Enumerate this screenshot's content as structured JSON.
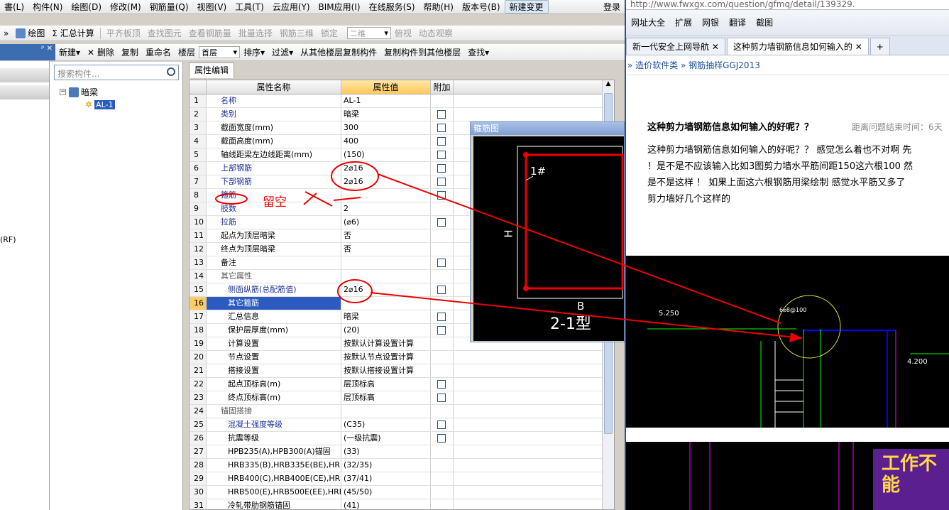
{
  "menu": [
    "書(L)",
    "构件(N)",
    "绘图(D)",
    "修改(M)",
    "钢筋量(Q)",
    "视图(V)",
    "工具(T)",
    "云应用(Y)",
    "BIM应用(I)",
    "在线服务(S)",
    "帮助(H)",
    "版本号(B)",
    "新建变更",
    "登录"
  ],
  "toolbar1": {
    "items": [
      "绘图",
      "Σ 汇总计算",
      "平齐板顶",
      "查找图元",
      "查看钢筋量",
      "批量选择",
      "钢筋三维",
      "锁定",
      "二维",
      "俯视",
      "动态观察"
    ]
  },
  "toolbar2": {
    "items": [
      "新建",
      "删除",
      "复制",
      "重命名"
    ],
    "floor_label": "楼层",
    "floor_value": "首层",
    "items2": [
      "排序",
      "过滤",
      "从其他楼层复制构件",
      "复制构件到其他楼层",
      "查找"
    ]
  },
  "left_strip": {
    "labels": [
      "(RF)"
    ]
  },
  "tree": {
    "search_placeholder": "搜索构件...",
    "root": "暗梁",
    "child": "AL-1"
  },
  "panel_tab": "属性编辑",
  "grid": {
    "headers": [
      "属性名称",
      "属性值",
      "附加"
    ],
    "rows": [
      {
        "n": "1",
        "k": "名称",
        "v": "AL-1",
        "cb": false,
        "c": "blue"
      },
      {
        "n": "2",
        "k": "类别",
        "v": "暗梁",
        "cb": true,
        "c": "blue"
      },
      {
        "n": "3",
        "k": "截面宽度(mm)",
        "v": "300",
        "cb": true,
        "c": ""
      },
      {
        "n": "4",
        "k": "截面高度(mm)",
        "v": "400",
        "cb": true,
        "c": ""
      },
      {
        "n": "5",
        "k": "轴线距梁左边线距离(mm)",
        "v": "(150)",
        "cb": true,
        "c": ""
      },
      {
        "n": "6",
        "k": "上部钢筋",
        "v": "2⌀16",
        "cb": true,
        "c": "blue"
      },
      {
        "n": "7",
        "k": "下部钢筋",
        "v": "2⌀16",
        "cb": true,
        "c": "blue"
      },
      {
        "n": "8",
        "k": "箍筋",
        "v": "",
        "cb": true,
        "c": "blue"
      },
      {
        "n": "9",
        "k": "肢数",
        "v": "2",
        "cb": false,
        "c": "blue"
      },
      {
        "n": "10",
        "k": "拉筋",
        "v": "(⌀6)",
        "cb": true,
        "c": "blue"
      },
      {
        "n": "11",
        "k": "起点为顶层暗梁",
        "v": "否",
        "cb": false,
        "c": ""
      },
      {
        "n": "12",
        "k": "终点为顶层暗梁",
        "v": "否",
        "cb": false,
        "c": ""
      },
      {
        "n": "13",
        "k": "备注",
        "v": "",
        "cb": true,
        "c": ""
      },
      {
        "n": "14",
        "k": "其它属性",
        "v": "",
        "cb": false,
        "c": "gray"
      },
      {
        "n": "15",
        "k": "侧面纵筋(总配筋值)",
        "v": "2⌀16",
        "cb": true,
        "c": "blue"
      },
      {
        "n": "16",
        "k": "其它箍筋",
        "v": "",
        "cb": false,
        "c": "sel"
      },
      {
        "n": "17",
        "k": "汇总信息",
        "v": "暗梁",
        "cb": true,
        "c": ""
      },
      {
        "n": "18",
        "k": "保护层厚度(mm)",
        "v": "(20)",
        "cb": true,
        "c": ""
      },
      {
        "n": "19",
        "k": "计算设置",
        "v": "按默认计算设置计算",
        "cb": false,
        "c": ""
      },
      {
        "n": "20",
        "k": "节点设置",
        "v": "按默认节点设置计算",
        "cb": false,
        "c": ""
      },
      {
        "n": "21",
        "k": "搭接设置",
        "v": "按默认搭接设置计算",
        "cb": false,
        "c": ""
      },
      {
        "n": "22",
        "k": "起点顶标高(m)",
        "v": "层顶标高",
        "cb": true,
        "c": ""
      },
      {
        "n": "23",
        "k": "终点顶标高(m)",
        "v": "层顶标高",
        "cb": true,
        "c": ""
      },
      {
        "n": "24",
        "k": "锚固搭接",
        "v": "",
        "cb": false,
        "c": "gray"
      },
      {
        "n": "25",
        "k": "混凝土强度等级",
        "v": "(C35)",
        "cb": true,
        "c": "blue"
      },
      {
        "n": "26",
        "k": "抗震等级",
        "v": "(一级抗震)",
        "cb": true,
        "c": ""
      },
      {
        "n": "27",
        "k": "HPB235(A),HPB300(A)锚固",
        "v": "(33)",
        "cb": false,
        "c": ""
      },
      {
        "n": "28",
        "k": "HRB335(B),HRB335E(BE),HRBF",
        "v": "(32/35)",
        "cb": false,
        "c": ""
      },
      {
        "n": "29",
        "k": "HRB400(C),HRB400E(CE),HRBF",
        "v": "(37/41)",
        "cb": false,
        "c": ""
      },
      {
        "n": "30",
        "k": "HRB500(E),HRB500E(EE),HRBF",
        "v": "(45/50)",
        "cb": false,
        "c": ""
      },
      {
        "n": "31",
        "k": "冷轧带肋钢筋锚固",
        "v": "(41)",
        "cb": false,
        "c": ""
      }
    ]
  },
  "popup": {
    "title": "箍筋图",
    "label_1": "1#",
    "label_h": "H",
    "label_b": "B",
    "type_label": "2-1型"
  },
  "annotation": {
    "note": "留空"
  },
  "browser": {
    "url": "http://www.fwxgx.com/question/gfmq/detail/139329.",
    "toolbar": [
      "网址大全",
      "扩展",
      "网银",
      "翻译",
      "截图"
    ],
    "tab1": "新一代安全上网导航",
    "tab2": "这种剪力墙钢筋信息如何输入的",
    "breadcrumb": [
      "造价软件类",
      "钢筋抽样GGJ2013"
    ],
    "question_title": "这种剪力墙钢筋信息如何输入的好呢？？",
    "question_time": "距离问题结束时间：6天",
    "body_lines": [
      "这种剪力墙钢筋信息如何输入的好呢？？ 感觉怎么着也不对啊 先",
      "！是不是不应该输入比如3图剪力墙水平筋间距150这六根100 然",
      "是不是这样 ！ 如果上面这六根钢筋用梁绘制 感觉水平筋又多了",
      "剪力墙好几个这样的"
    ],
    "cad_labels": [
      "5.250",
      "6⌀8@100",
      "4.200"
    ],
    "ad_text": "工作不能"
  }
}
